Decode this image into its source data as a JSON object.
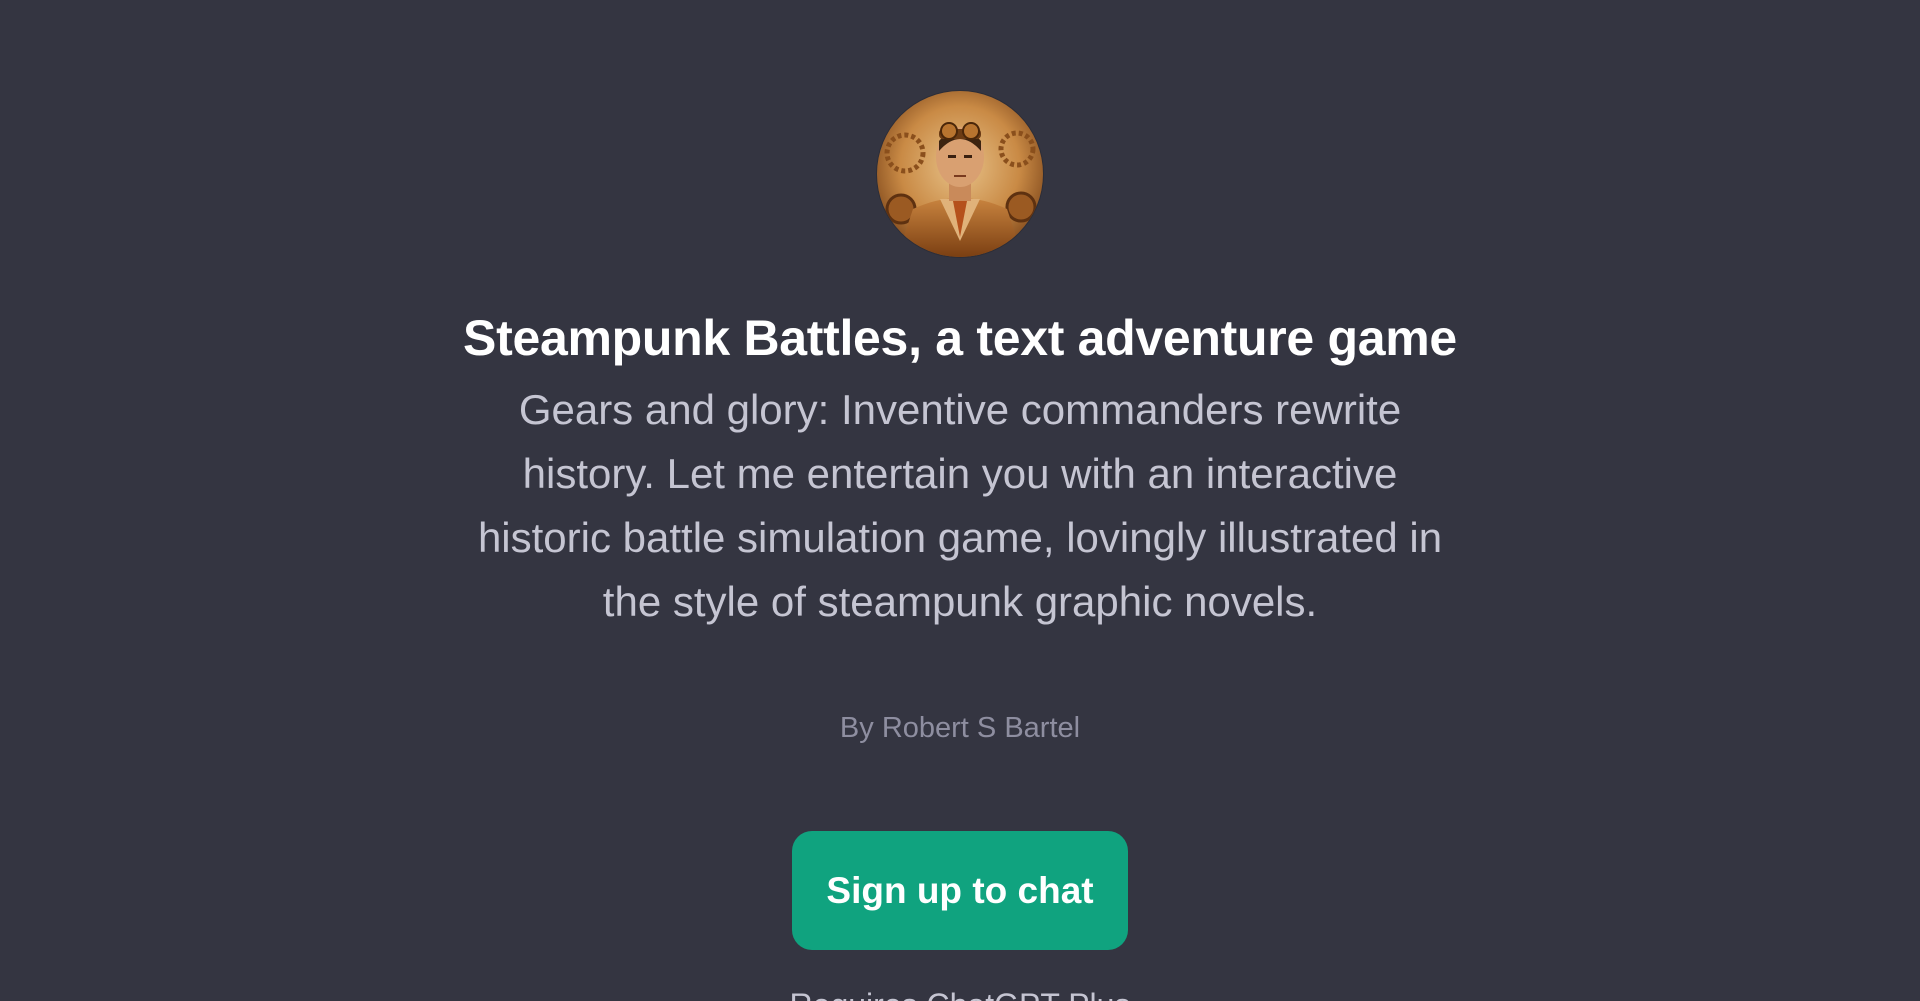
{
  "gpt": {
    "avatar_icon": "steampunk-commander-avatar",
    "title": "Steampunk Battles, a text adventure game",
    "description": "Gears and glory: Inventive commanders rewrite history. Let me entertain you with an interactive historic battle simulation game, lovingly illustrated in the style of steampunk graphic novels.",
    "author": "By Robert S Bartel"
  },
  "actions": {
    "signup_label": "Sign up to chat"
  },
  "footer": {
    "partial_text": "Requires ChatGPT Plus"
  },
  "colors": {
    "background": "#343541",
    "accent": "#10a37f",
    "title": "#ffffff",
    "description": "#c5c5d2",
    "author": "#8e8ea0"
  }
}
